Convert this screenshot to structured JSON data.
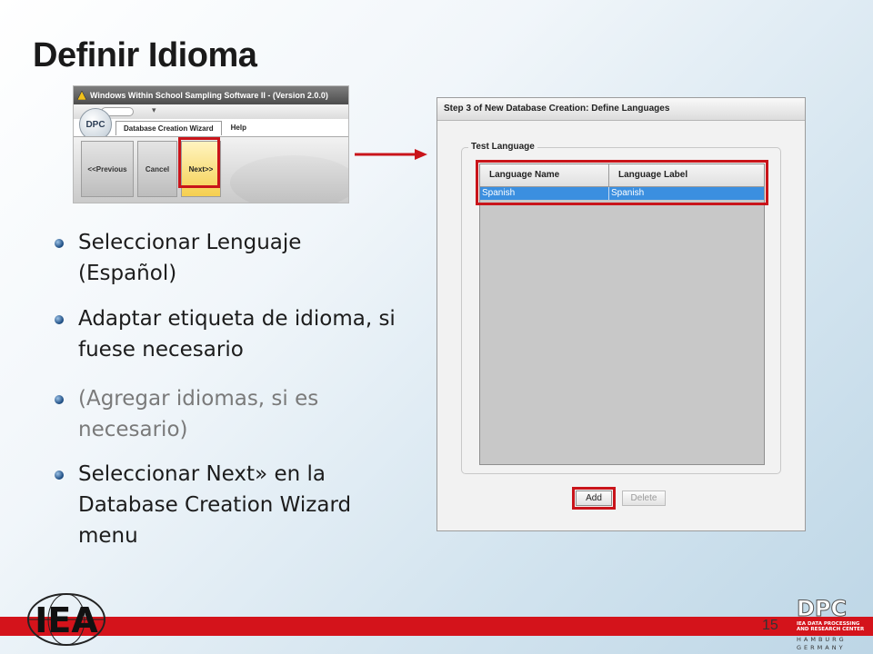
{
  "slide": {
    "title": "Definir Idioma",
    "page_number": "15"
  },
  "wizard": {
    "window_title": "Windows Within School Sampling Software II - (Version 2.0.0)",
    "logo_text": "DPC",
    "tabs": [
      "Database Creation Wizard",
      "Help"
    ],
    "buttons": {
      "previous": "<<Previous",
      "cancel": "Cancel",
      "next": "Next>>"
    }
  },
  "dialog": {
    "title": "Step 3 of New Database Creation: Define Languages",
    "group_label": "Test Language",
    "columns": [
      "Language Name",
      "Language Label"
    ],
    "rows": [
      {
        "name": "Spanish",
        "label": "Spanish"
      }
    ],
    "buttons": {
      "add": "Add",
      "delete": "Delete"
    }
  },
  "bullets": [
    "Seleccionar Lenguaje (Español)",
    "Adaptar etiqueta de idioma, si fuese necesario",
    "(Agregar idiomas, si es necesario)",
    "Seleccionar Next» en la Database Creation Wizard menu"
  ],
  "footer": {
    "left_logo": "IEA",
    "right_logo": "DPC",
    "right_logo_sub": [
      "IEA DATA PROCESSING",
      "AND RESEARCH CENTER"
    ],
    "right_logo_city": [
      "HAMBURG",
      "GERMANY"
    ]
  },
  "colors": {
    "highlight_red": "#c9141a",
    "selection_blue": "#3b8fe0",
    "footer_red": "#d4131b"
  }
}
